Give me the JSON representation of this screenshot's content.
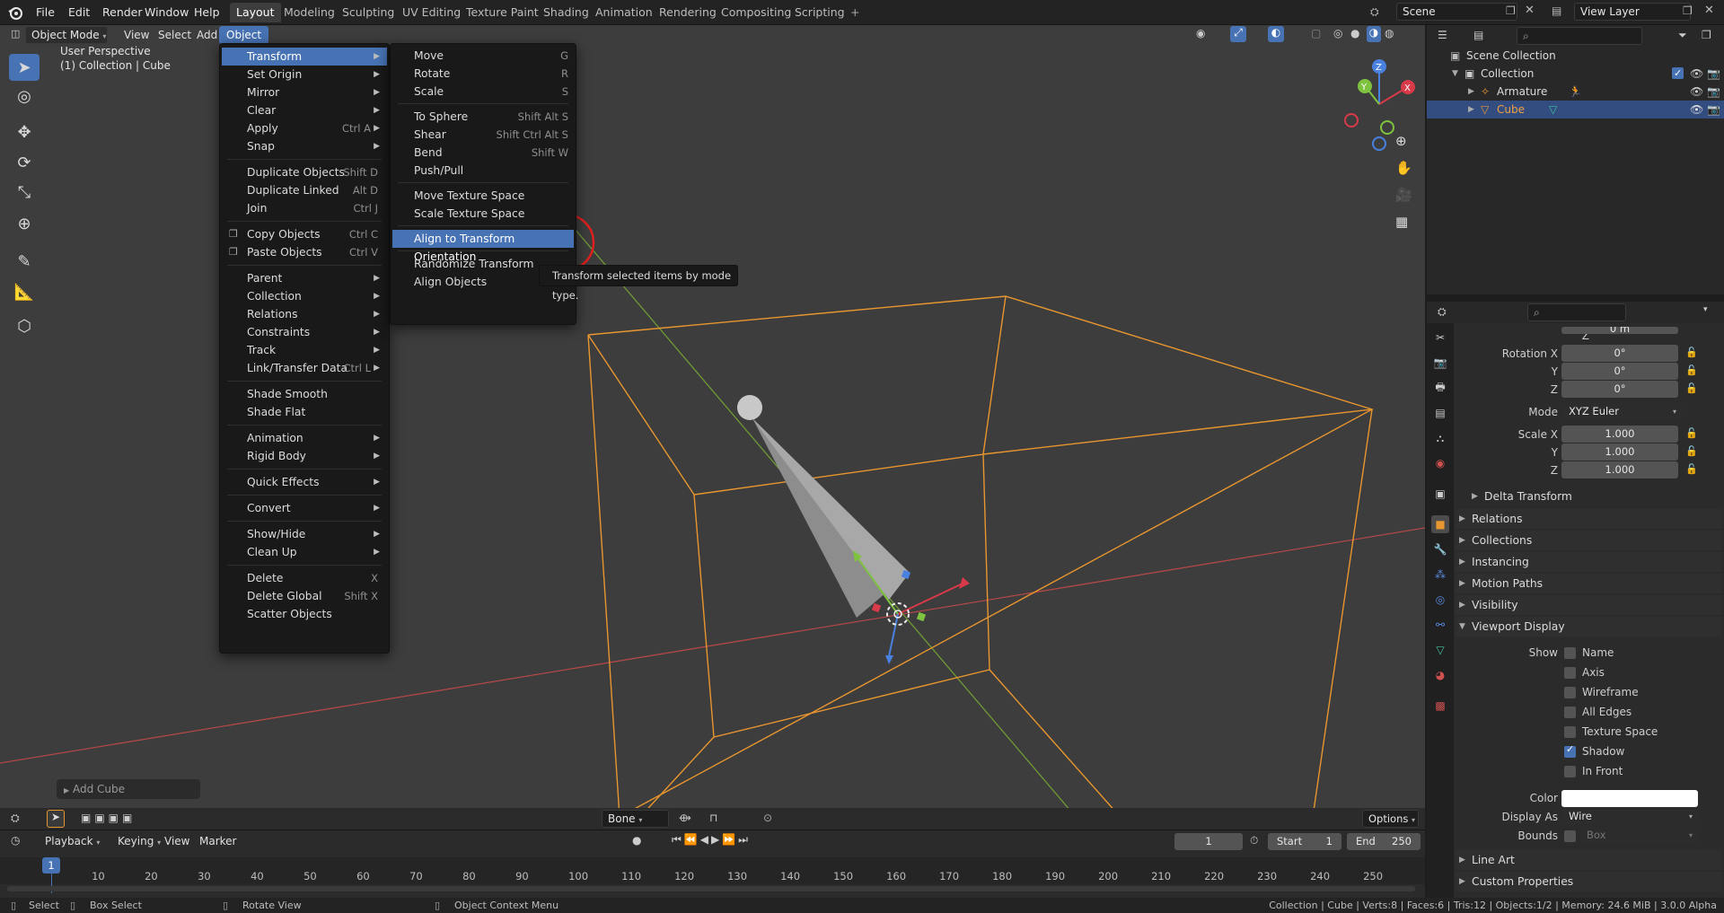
{
  "topbar": {
    "menus": [
      "File",
      "Edit",
      "Render",
      "Window",
      "Help"
    ],
    "workspaces": [
      "Layout",
      "Modeling",
      "Sculpting",
      "UV Editing",
      "Texture Paint",
      "Shading",
      "Animation",
      "Rendering",
      "Compositing",
      "Scripting"
    ],
    "active_workspace": "Layout",
    "add_tab": "+",
    "scene_value": "Scene",
    "view_layer_value": "View Layer"
  },
  "viewport": {
    "mode": "Object Mode",
    "header_menus": [
      "View",
      "Select",
      "Add",
      "Object"
    ],
    "info_line1": "User Perspective",
    "info_line2": "(1) Collection | Cube",
    "last_op": "Add Cube",
    "bone_dropdown": "Bone",
    "options_button": "Options",
    "gizmo_axes": {
      "x": "X",
      "y": "Y",
      "z": "Z"
    }
  },
  "object_menu": {
    "items": [
      {
        "label": "Transform",
        "sub": true,
        "hl": true
      },
      {
        "label": "Set Origin",
        "sub": true
      },
      {
        "label": "Mirror",
        "sub": true
      },
      {
        "label": "Clear",
        "sub": true
      },
      {
        "label": "Apply",
        "shortcut": "Ctrl A",
        "sub": true
      },
      {
        "label": "Snap",
        "sub": true
      },
      {
        "sep": true
      },
      {
        "label": "Duplicate Objects",
        "shortcut": "Shift D"
      },
      {
        "label": "Duplicate Linked",
        "shortcut": "Alt D"
      },
      {
        "label": "Join",
        "shortcut": "Ctrl J"
      },
      {
        "sep": true
      },
      {
        "label": "Copy Objects",
        "shortcut": "Ctrl C",
        "icon": "copy-icon"
      },
      {
        "label": "Paste Objects",
        "shortcut": "Ctrl V",
        "icon": "paste-icon"
      },
      {
        "sep": true
      },
      {
        "label": "Parent",
        "sub": true
      },
      {
        "label": "Collection",
        "sub": true
      },
      {
        "label": "Relations",
        "sub": true
      },
      {
        "label": "Constraints",
        "sub": true
      },
      {
        "label": "Track",
        "sub": true
      },
      {
        "label": "Link/Transfer Data",
        "shortcut": "Ctrl L",
        "sub": true
      },
      {
        "sep": true
      },
      {
        "label": "Shade Smooth"
      },
      {
        "label": "Shade Flat"
      },
      {
        "sep": true
      },
      {
        "label": "Animation",
        "sub": true
      },
      {
        "label": "Rigid Body",
        "sub": true
      },
      {
        "sep": true
      },
      {
        "label": "Quick Effects",
        "sub": true
      },
      {
        "sep": true
      },
      {
        "label": "Convert",
        "sub": true
      },
      {
        "sep": true
      },
      {
        "label": "Show/Hide",
        "sub": true
      },
      {
        "label": "Clean Up",
        "sub": true
      },
      {
        "sep": true
      },
      {
        "label": "Delete",
        "shortcut": "X"
      },
      {
        "label": "Delete Global",
        "shortcut": "Shift X"
      },
      {
        "label": "Scatter Objects"
      }
    ]
  },
  "transform_menu": {
    "items": [
      {
        "label": "Move",
        "shortcut": "G"
      },
      {
        "label": "Rotate",
        "shortcut": "R"
      },
      {
        "label": "Scale",
        "shortcut": "S"
      },
      {
        "sep": true
      },
      {
        "label": "To Sphere",
        "shortcut": "Shift Alt S"
      },
      {
        "label": "Shear",
        "shortcut": "Shift Ctrl Alt S"
      },
      {
        "label": "Bend",
        "shortcut": "Shift W"
      },
      {
        "label": "Push/Pull"
      },
      {
        "sep": true
      },
      {
        "label": "Move Texture Space"
      },
      {
        "label": "Scale Texture Space"
      },
      {
        "sep": true
      },
      {
        "label": "Align to Transform Orientation",
        "hl": true
      },
      {
        "sep": true
      },
      {
        "label": "Randomize Transform"
      },
      {
        "label": "Align Objects"
      }
    ],
    "tooltip": "Transform selected items by mode type."
  },
  "outliner": {
    "search_placeholder": "",
    "rows": [
      {
        "label": "Scene Collection",
        "indent": 0
      },
      {
        "label": "Collection",
        "indent": 1
      },
      {
        "label": "Armature",
        "indent": 2
      },
      {
        "label": "Cube",
        "indent": 2,
        "selected": true
      }
    ]
  },
  "properties": {
    "loc_z_value": "0 m",
    "loc_z_label": "Z",
    "rotation_x_label": "Rotation X",
    "rotation_y_label": "Y",
    "rotation_z_label": "Z",
    "rotation": [
      "0°",
      "0°",
      "0°"
    ],
    "mode_label": "Mode",
    "mode_value": "XYZ Euler",
    "scale_x_label": "Scale X",
    "scale_y_label": "Y",
    "scale_z_label": "Z",
    "scale": [
      "1.000",
      "1.000",
      "1.000"
    ],
    "delta_transform": "Delta Transform",
    "panels_closed": [
      "Relations",
      "Collections",
      "Instancing",
      "Motion Paths",
      "Visibility"
    ],
    "viewport_display": "Viewport Display",
    "show_label": "Show",
    "show_options": [
      {
        "label": "Name",
        "on": false
      },
      {
        "label": "Axis",
        "on": false
      },
      {
        "label": "Wireframe",
        "on": false
      },
      {
        "label": "All Edges",
        "on": false
      },
      {
        "label": "Texture Space",
        "on": false
      },
      {
        "label": "Shadow",
        "on": true
      },
      {
        "label": "In Front",
        "on": false
      }
    ],
    "color_label": "Color",
    "display_as_label": "Display As",
    "display_as_value": "Wire",
    "bounds_label": "Bounds",
    "bounds_value": "Box",
    "panels_bottom": [
      "Line Art",
      "Custom Properties"
    ]
  },
  "timeline": {
    "menus": [
      "Playback",
      "Keying",
      "View",
      "Marker"
    ],
    "current_frame": "1",
    "start_label": "Start",
    "start_value": "1",
    "end_label": "End",
    "end_value": "250",
    "ticks": [
      "1",
      "10",
      "20",
      "30",
      "40",
      "50",
      "60",
      "70",
      "80",
      "90",
      "100",
      "110",
      "120",
      "130",
      "140",
      "150",
      "160",
      "170",
      "180",
      "190",
      "200",
      "210",
      "220",
      "230",
      "240",
      "250"
    ]
  },
  "statusbar": {
    "left": [
      "Select",
      "Box Select",
      "Rotate View",
      "Object Context Menu"
    ],
    "right": "Collection | Cube | Verts:8 | Faces:6 | Tris:12 | Objects:1/2 | Memory: 24.6 MiB | 3.0.0 Alpha"
  },
  "colors": {
    "accent": "#4772b3",
    "selection_orange": "#f0a040",
    "cursor_ring": "#e0201e"
  }
}
